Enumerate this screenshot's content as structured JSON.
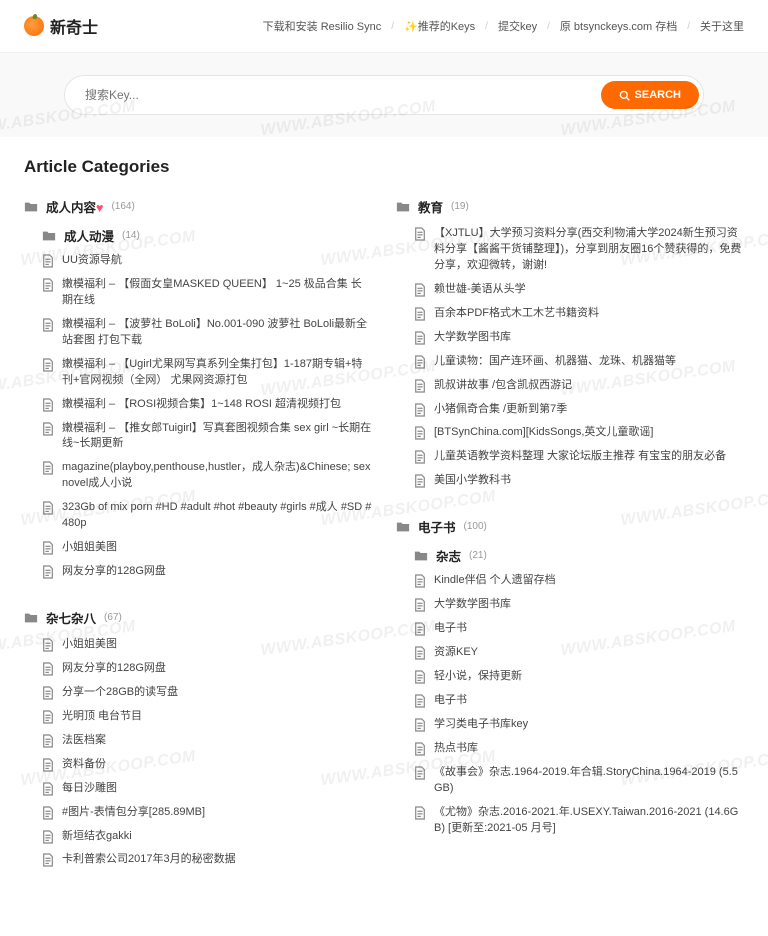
{
  "site": {
    "title": "新奇士"
  },
  "nav": {
    "download": "下载和安装 Resilio Sync",
    "keys": "推荐的Keys",
    "submit": "提交key",
    "archive": "原 btsynckeys.com 存档",
    "about": "关于这里"
  },
  "search": {
    "placeholder": "搜索Key...",
    "button": "SEARCH"
  },
  "page_title": "Article Categories",
  "watermark": "WWW.ABSKOOP.COM",
  "left": [
    {
      "name": "成人内容",
      "heart": true,
      "count": "(164)",
      "sub": {
        "name": "成人动漫",
        "count": "(14)"
      },
      "items": [
        "UU资源导航",
        "嫩模福利 –  【假面女皇MASKED QUEEN】 1~25 极品合集 长期在线",
        "嫩模福利 –  【波萝社 BoLoli】No.001-090 波萝社 BoLoli最新全站套图 打包下载",
        "嫩模福利 –  【Ugirl尤果网写真系列全集打包】1-187期专辑+特刊+官网视频（全网） 尤果网资源打包",
        "嫩模福利 –  【ROSI视频合集】1~148 ROSI 超清视频打包",
        "嫩模福利 –  【推女郎Tuigirl】写真套图视频合集 sex girl ~长期在线~长期更新",
        "magazine(playboy,penthouse,hustler，成人杂志)&Chinese; sex novel成人小说",
        "323Gb of mix porn #HD #adult #hot #beauty #girls #成人 #SD #480p",
        "小姐姐美图",
        "网友分享的128G网盘"
      ]
    },
    {
      "name": "杂七杂八",
      "count": "(67)",
      "items": [
        "小姐姐美图",
        "网友分享的128G网盘",
        "分享一个28GB的读写盘",
        "光明顶 电台节目",
        "法医档案",
        "资料备份",
        "每日沙雕图",
        "#图片-表情包分享[285.89MB]",
        "新垣结衣gakki",
        "卡利普索公司2017年3月的秘密数据"
      ]
    }
  ],
  "right": [
    {
      "name": "教育",
      "count": "(19)",
      "items": [
        "【XJTLU】大学预习资料分享(西交利物浦大学2024新生预习资料分享【酱酱干货铺整理】)，分享到朋友圈16个赞获得的，免费分享，欢迎微转，谢谢!",
        "赖世雄-美语从头学",
        "百余本PDF格式木工木艺书籍资料",
        "大学数学图书库",
        "儿童读物：国产连环画、机器猫、龙珠、机器猫等",
        "凯叔讲故事 /包含凯叔西游记",
        "小猪佩奇合集 /更新到第7季",
        "[BTSynChina.com][KidsSongs,英文儿童歌谣]",
        "儿童英语教学资料整理 大家论坛版主推荐 有宝宝的朋友必备",
        "美国小学教科书"
      ]
    },
    {
      "name": "电子书",
      "count": "(100)",
      "sub": {
        "name": "杂志",
        "count": "(21)"
      },
      "items": [
        "Kindle伴侣 个人遗留存档",
        "大学数学图书库",
        "电子书",
        "资源KEY",
        "轻小说，保持更新",
        "电子书",
        "学习类电子书库key",
        "热点书库",
        "《故事会》杂志.1964-2019.年合辑.StoryChina.1964-2019 (5.5GB)",
        "《尤物》杂志.2016-2021.年.USEXY.Taiwan.2016-2021 (14.6GB) [更新至:2021-05 月号]"
      ]
    }
  ]
}
